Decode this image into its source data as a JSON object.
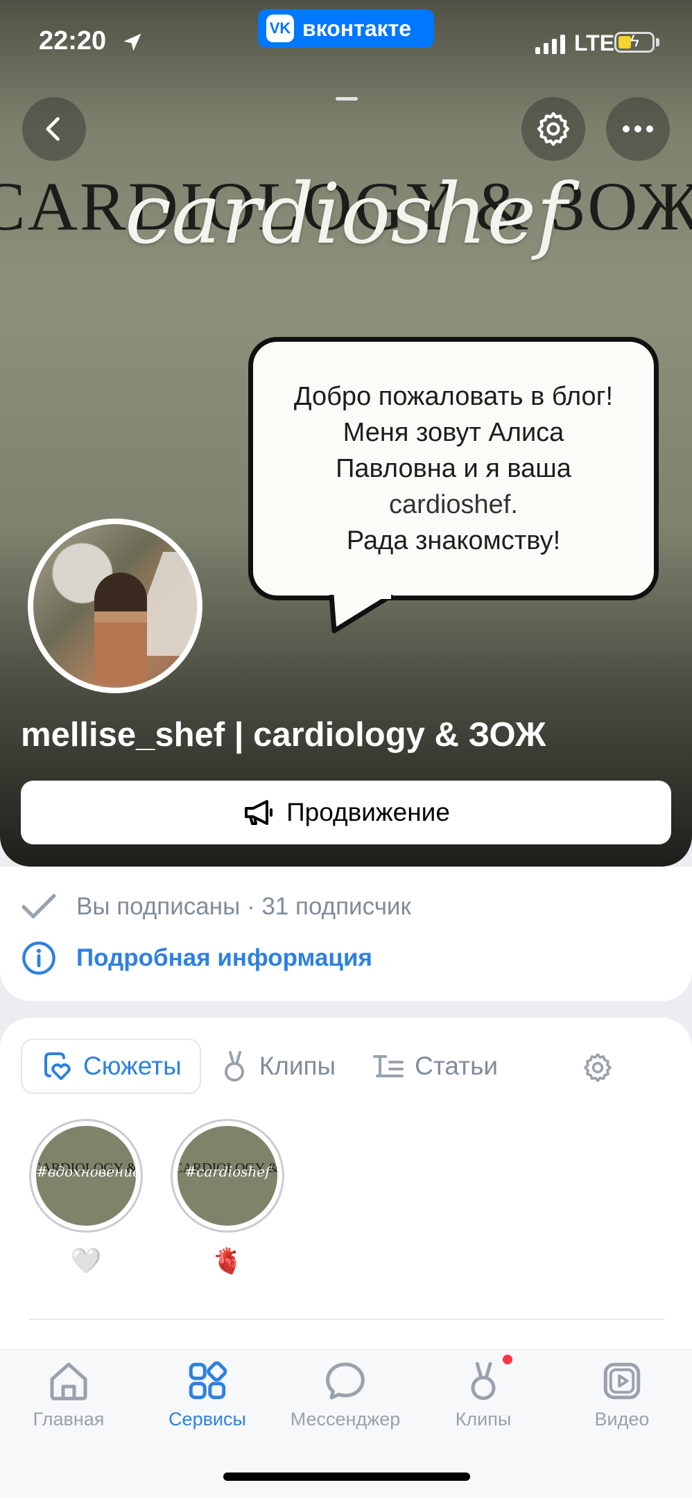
{
  "status_bar": {
    "time": "22:20",
    "network": "LTE"
  },
  "app_badge": {
    "logo": "VK",
    "label": "вконтакте"
  },
  "cover": {
    "brand_line": "CARDIOLOGY & ЗОЖ",
    "script_logo": "cardioshef",
    "bubble_lines": [
      "Добро пожаловать в блог!",
      "Меня зовут Алиса",
      "Павловна и я ваша",
      "cardioshef.",
      "Рада знакомству!"
    ]
  },
  "group": {
    "name": "mellise_shef | cardiology & ЗОЖ",
    "promo_button": "Продвижение",
    "subscribed_text": "Вы подписаны",
    "separator": " · ",
    "subscribers": "31 подписчик",
    "details_link": "Подробная информация"
  },
  "content_tabs": [
    {
      "label": "Сюжеты",
      "icon": "heart-story-icon",
      "active": true
    },
    {
      "label": "Клипы",
      "icon": "clips-icon",
      "active": false
    },
    {
      "label": "Статьи",
      "icon": "articles-icon",
      "active": false
    }
  ],
  "stories": [
    {
      "thumb_brand": "CARDIOLOGY & ЗОЖ",
      "thumb_script": "#вдохновение",
      "emoji": "🤍"
    },
    {
      "thumb_brand": "CARDIOLOGY & ЗОЖ",
      "thumb_script": "#cardioshef",
      "emoji": "🫀"
    }
  ],
  "bottom_nav": [
    {
      "label": "Главная",
      "icon": "home-icon",
      "active": false
    },
    {
      "label": "Сервисы",
      "icon": "services-icon",
      "active": true
    },
    {
      "label": "Мессенджер",
      "icon": "messenger-icon",
      "active": false
    },
    {
      "label": "Клипы",
      "icon": "clips-icon",
      "active": false,
      "badge": true
    },
    {
      "label": "Видео",
      "icon": "video-icon",
      "active": false
    }
  ],
  "colors": {
    "accent": "#2d81e0",
    "vk_blue": "#0077ff",
    "cover_bg": "#80826f",
    "badge_red": "#ff3347"
  }
}
